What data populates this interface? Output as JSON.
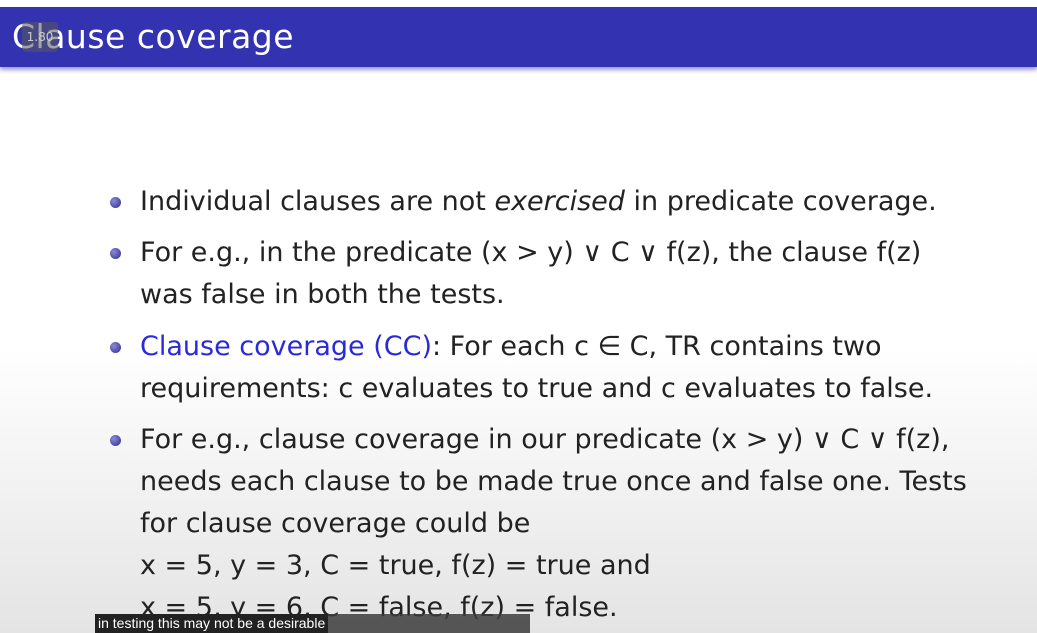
{
  "slide": {
    "title": "Clause coverage",
    "speed_badge": "1.80",
    "bullets": [
      {
        "lines": [
          [
            "Individual clauses are not ",
            "exercised",
            " in predicate coverage."
          ]
        ]
      },
      {
        "line1": "For e.g., in the predicate (x > y) ∨ C ∨ f(z), the clause f(z)",
        "line2": "was false in both the tests."
      },
      {
        "term": "Clause coverage (CC)",
        "line1_rest": ": For each c ∈ C, TR contains two",
        "line2": "requirements: c evaluates to true and c evaluates to false."
      },
      {
        "line1": "For e.g., clause coverage in our predicate (x > y) ∨ C ∨ f(z),",
        "line2": "needs each clause to be made true once and false one. Tests",
        "line3": "for clause coverage could be",
        "line4": "x = 5, y = 3, C = true, f(z) = true and",
        "line5": "x = 5, y = 6, C = false, f(z) = false."
      }
    ]
  },
  "video": {
    "caption": "in testing this may not be a desirable"
  },
  "colors": {
    "titlebar": "#3333b2",
    "term": "#2a2ad8"
  }
}
